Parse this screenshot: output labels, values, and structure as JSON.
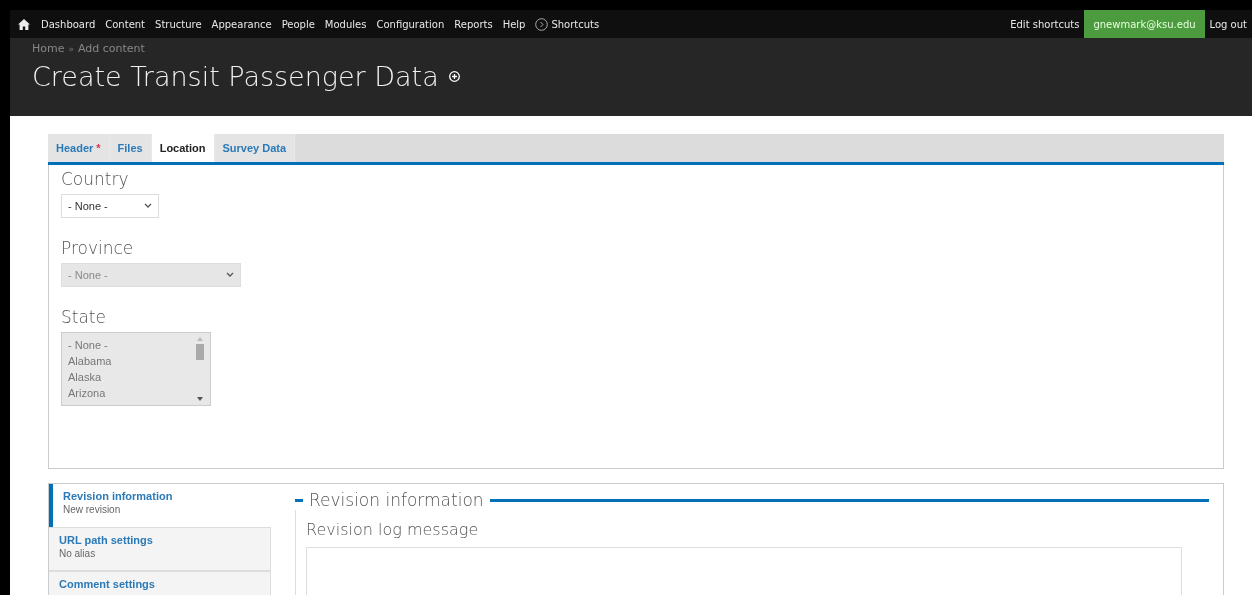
{
  "toolbar": {
    "items": [
      {
        "label": "Dashboard"
      },
      {
        "label": "Content"
      },
      {
        "label": "Structure"
      },
      {
        "label": "Appearance"
      },
      {
        "label": "People"
      },
      {
        "label": "Modules"
      },
      {
        "label": "Configuration"
      },
      {
        "label": "Reports"
      },
      {
        "label": "Help"
      },
      {
        "label": "Shortcuts",
        "kind": "shortcuts"
      }
    ],
    "right": [
      {
        "label": "Edit shortcuts",
        "kind": "plain"
      },
      {
        "label": "gnewmark@ksu.edu",
        "kind": "user"
      },
      {
        "label": "Log out",
        "kind": "plain"
      }
    ]
  },
  "breadcrumb": [
    {
      "label": "Home"
    },
    {
      "label": "Add content"
    }
  ],
  "breadcrumb_separator": "»",
  "page_title": "Create Transit Passenger Data",
  "tabs": [
    {
      "label": "Header",
      "required": true,
      "selected": false
    },
    {
      "label": "Files",
      "required": false,
      "selected": false
    },
    {
      "label": "Location",
      "required": false,
      "selected": true
    },
    {
      "label": "Survey Data",
      "required": false,
      "selected": false
    }
  ],
  "required_mark": "*",
  "fields": [
    {
      "label": "Country",
      "kind": "select",
      "value": "- None -",
      "disabled": false
    },
    {
      "label": "Province",
      "kind": "select",
      "value": "- None -",
      "disabled": true
    },
    {
      "label": "State",
      "kind": "listbox",
      "options": [
        "- None -",
        "Alabama",
        "Alaska",
        "Arizona"
      ],
      "disabled": true
    }
  ],
  "vertical_tabs": [
    {
      "title": "Revision information",
      "summary": "New revision",
      "selected": true
    },
    {
      "title": "URL path settings",
      "summary": "No alias",
      "selected": false
    },
    {
      "title": "Comment settings",
      "selected": false
    }
  ],
  "pane": {
    "legend": "Revision information",
    "field_label": "Revision log message"
  }
}
